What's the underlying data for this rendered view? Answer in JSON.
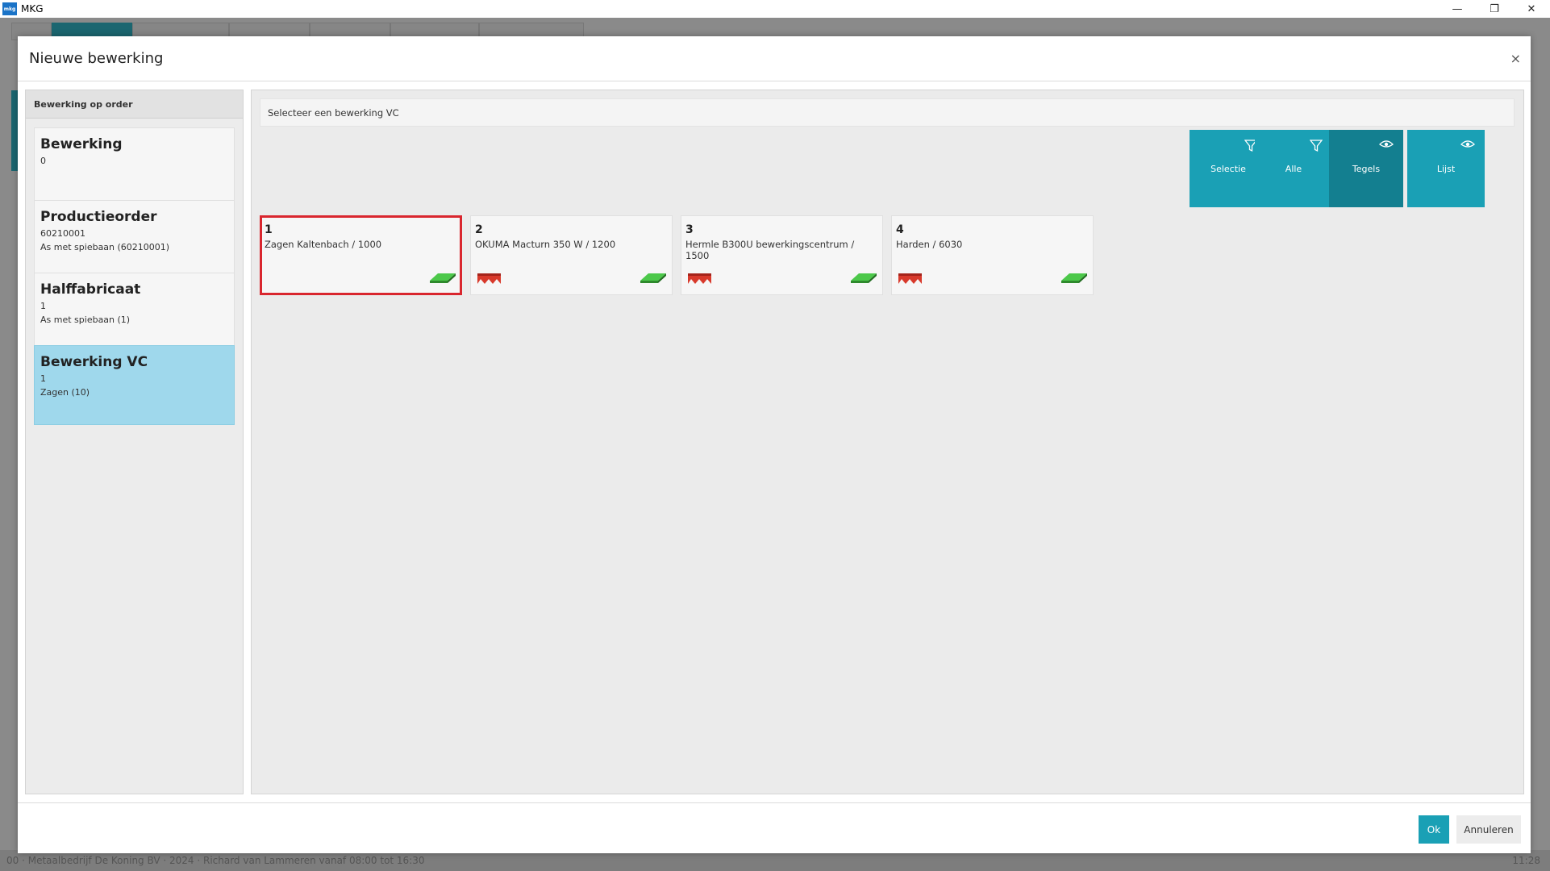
{
  "window": {
    "title": "MKG",
    "logo_text": "mkg"
  },
  "dialog": {
    "title": "Nieuwe bewerking",
    "close_label": "×"
  },
  "left_panel": {
    "header": "Bewerking op order",
    "cards": [
      {
        "title": "Bewerking",
        "lines": [
          "0"
        ]
      },
      {
        "title": "Productieorder",
        "lines": [
          "60210001",
          "As met spiebaan (60210001)"
        ]
      },
      {
        "title": "Halffabricaat",
        "lines": [
          "1",
          "As met spiebaan (1)"
        ]
      },
      {
        "title": "Bewerking VC",
        "lines": [
          "1",
          "Zagen (10)"
        ],
        "selected": true
      }
    ]
  },
  "main": {
    "prompt": "Selecteer een bewerking VC",
    "toolbar": [
      {
        "label": "Selectie",
        "icon": "filter-icon"
      },
      {
        "label": "Alle",
        "icon": "filter-icon"
      },
      {
        "label": "Tegels",
        "icon": "eye-icon",
        "active": true
      },
      {
        "label": "Lijst",
        "icon": "eye-icon"
      }
    ],
    "tiles": [
      {
        "number": "1",
        "description": "Zagen Kaltenbach / 1000",
        "selected": true,
        "red_icon": false,
        "green_icon": true
      },
      {
        "number": "2",
        "description": "OKUMA Macturn 350 W / 1200",
        "red_icon": true,
        "green_icon": true
      },
      {
        "number": "3",
        "description": "Hermle B300U bewerkingscentrum / 1500",
        "red_icon": true,
        "green_icon": true
      },
      {
        "number": "4",
        "description": "Harden / 6030",
        "red_icon": true,
        "green_icon": true
      }
    ]
  },
  "footer": {
    "ok_label": "Ok",
    "cancel_label": "Annuleren"
  },
  "background": {
    "status_text": "00 · Metaalbedrijf De Koning BV · 2024 · Richard van Lammeren vanaf 08:00 tot 16:30",
    "status_right": "11:28"
  },
  "colors": {
    "accent": "#1aa0b5",
    "accent_dark": "#137f90",
    "selected_card": "#9fd8ec",
    "selected_tile_border": "#d9262e"
  }
}
